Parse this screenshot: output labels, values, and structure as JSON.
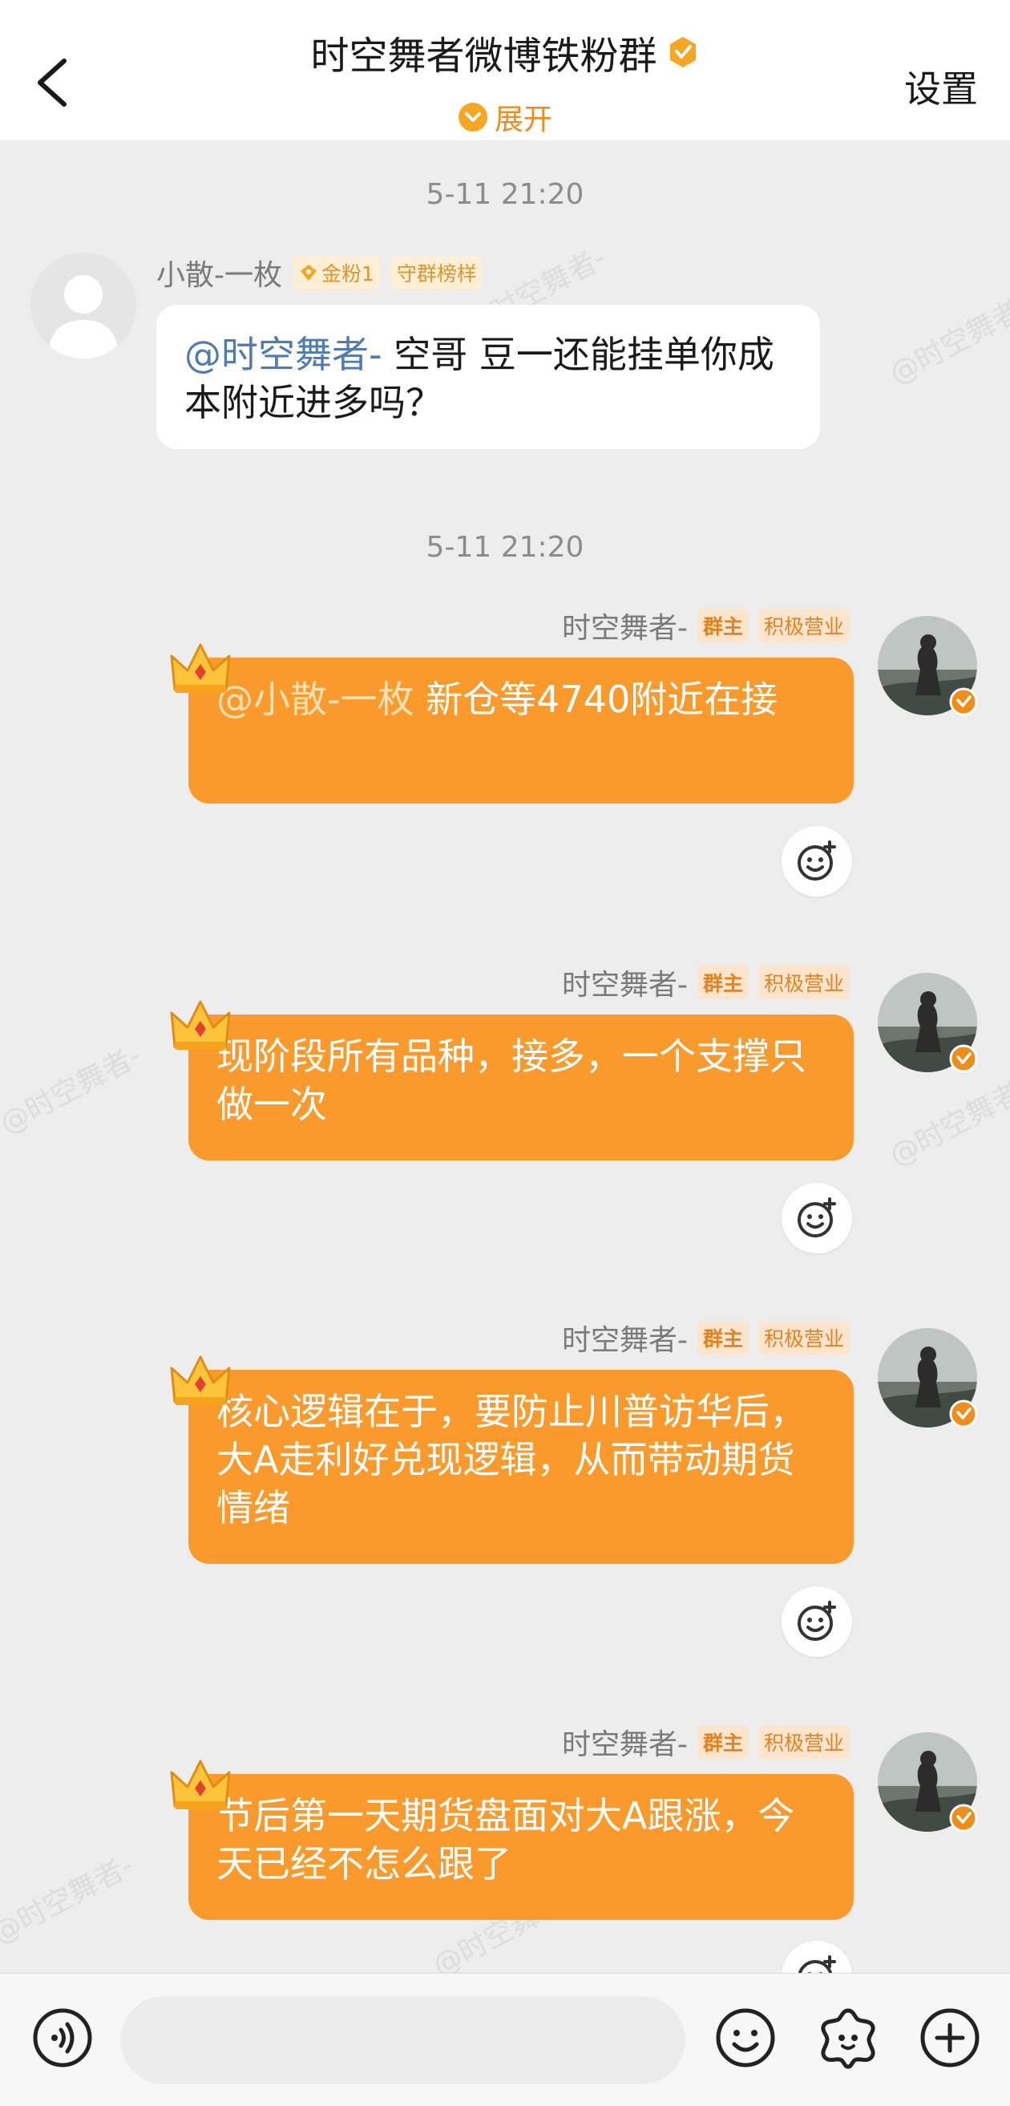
{
  "header": {
    "title": "时空舞者微博铁粉群",
    "expand_label": "展开",
    "settings_label": "设置"
  },
  "messages": [
    {
      "time": "5-11 21:20",
      "side": "left",
      "sender": "小散-一枚",
      "badges": [
        "金粉1",
        "守群榜样"
      ],
      "mention": "@时空舞者-",
      "text": " 空哥 豆一还能挂单你成本附近进多吗？"
    },
    {
      "time": "5-11 21:20",
      "side": "right",
      "sender": "时空舞者-",
      "badges": [
        "群主",
        "积极营业"
      ],
      "mention": "@小散-一枚",
      "text": " 新仓等4740附近在接"
    },
    {
      "side": "right",
      "sender": "时空舞者-",
      "badges": [
        "群主",
        "积极营业"
      ],
      "text": "现阶段所有品种，接多，一个支撑只做一次"
    },
    {
      "side": "right",
      "sender": "时空舞者-",
      "badges": [
        "群主",
        "积极营业"
      ],
      "text": "核心逻辑在于，要防止川普访华后，大A走利好兑现逻辑，从而带动期货情绪"
    },
    {
      "side": "right",
      "sender": "时空舞者-",
      "badges": [
        "群主",
        "积极营业"
      ],
      "text": "节后第一天期货盘面对大A跟涨，今天已经不怎么跟了"
    }
  ],
  "watermark_text": "@时空舞者-",
  "input": {
    "placeholder": ""
  },
  "colors": {
    "accent": "#fb9a2c",
    "background": "#ededed",
    "mention_blue": "#4f7bb0"
  },
  "icons": [
    "back-arrow-icon",
    "verified-badge-icon",
    "chevron-down-icon",
    "crown-icon",
    "add-reaction-icon",
    "voice-icon",
    "emoji-icon",
    "sticker-icon",
    "plus-icon"
  ]
}
